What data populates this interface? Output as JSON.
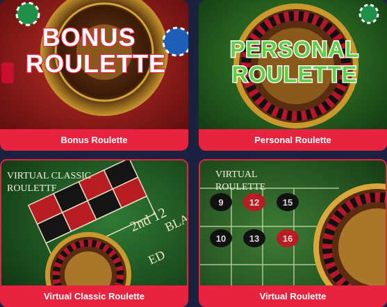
{
  "games": [
    {
      "title": "Bonus Roulette",
      "art_line1": "BONUS",
      "art_line2": "ROULETTE"
    },
    {
      "title": "Personal Roulette",
      "art_line1": "PERSONAL",
      "art_line2": "ROULETTE"
    },
    {
      "title": "Virtual Classic Roulette",
      "art_line1": "VIRTUAL CLASSIC",
      "art_line2": "ROULETTF",
      "table_text_1": "2nd 12",
      "table_text_2": "BLA",
      "table_text_3": "ED"
    },
    {
      "title": "Virtual Roulette",
      "art_line1": "VIRTUAL",
      "art_line2": "ROULETTE",
      "table_numbers": [
        "9",
        "12",
        "15",
        "10",
        "13",
        "16"
      ]
    }
  ],
  "colors": {
    "page_bg": "#1b2140",
    "label_bg": "#e8233f",
    "label_text": "#ffffff"
  }
}
